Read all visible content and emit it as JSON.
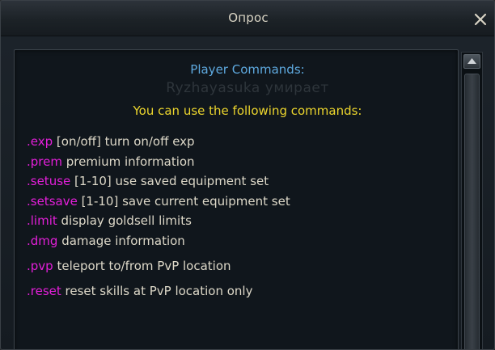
{
  "window": {
    "title": "Опрос"
  },
  "background_text": "Ryzhayasuka умирает",
  "content": {
    "heading": "Player Commands:",
    "subheading": "You can use the following commands:",
    "commands": [
      {
        "name": ".exp",
        "desc": " [on/off] turn on/off exp"
      },
      {
        "name": ".prem",
        "desc": " premium information"
      },
      {
        "name": ".setuse",
        "desc": " [1-10] use saved equipment set"
      },
      {
        "name": ".setsave",
        "desc": " [1-10] save current equipment set"
      },
      {
        "name": ".limit",
        "desc": " display goldsell limits"
      },
      {
        "name": ".dmg",
        "desc": " damage information"
      },
      {
        "name": ".pvp",
        "desc": " teleport to/from PvP location"
      },
      {
        "name": ".reset",
        "desc": " reset skills at PvP location only"
      }
    ]
  },
  "colors": {
    "heading": "#5ea9df",
    "subheading": "#ecd52d",
    "command": "#e31fd9",
    "text": "#ddd8c8"
  },
  "icons": {
    "close": "close-icon",
    "scroll_up": "chevron-up-icon"
  }
}
